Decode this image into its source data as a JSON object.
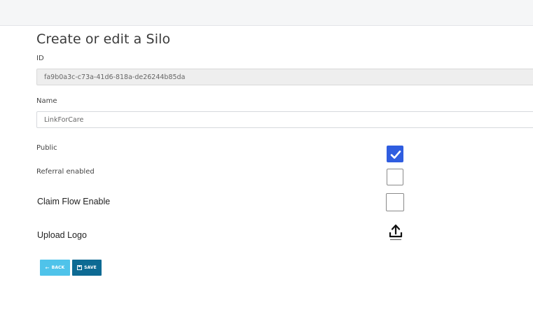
{
  "page": {
    "title": "Create or edit a Silo"
  },
  "fields": {
    "id": {
      "label": "ID",
      "value": "fa9b0a3c-c73a-41d6-818a-de26244b85da"
    },
    "name": {
      "label": "Name",
      "value": "LinkForCare"
    }
  },
  "options": {
    "public": {
      "label": "Public",
      "checked": true
    },
    "referral": {
      "label": "Referral enabled",
      "checked": false
    },
    "claim_flow": {
      "label": "Claim Flow Enable",
      "checked": false
    }
  },
  "upload": {
    "label": "Upload Logo",
    "icon": "upload-icon"
  },
  "buttons": {
    "back": {
      "label": "BACK",
      "icon": "arrow-left-icon"
    },
    "save": {
      "label": "SAVE",
      "icon": "floppy-disk-icon"
    }
  },
  "colors": {
    "checkbox_checked": "#2f5de0",
    "back_button": "#4fc3ea",
    "save_button": "#0d6a93"
  }
}
